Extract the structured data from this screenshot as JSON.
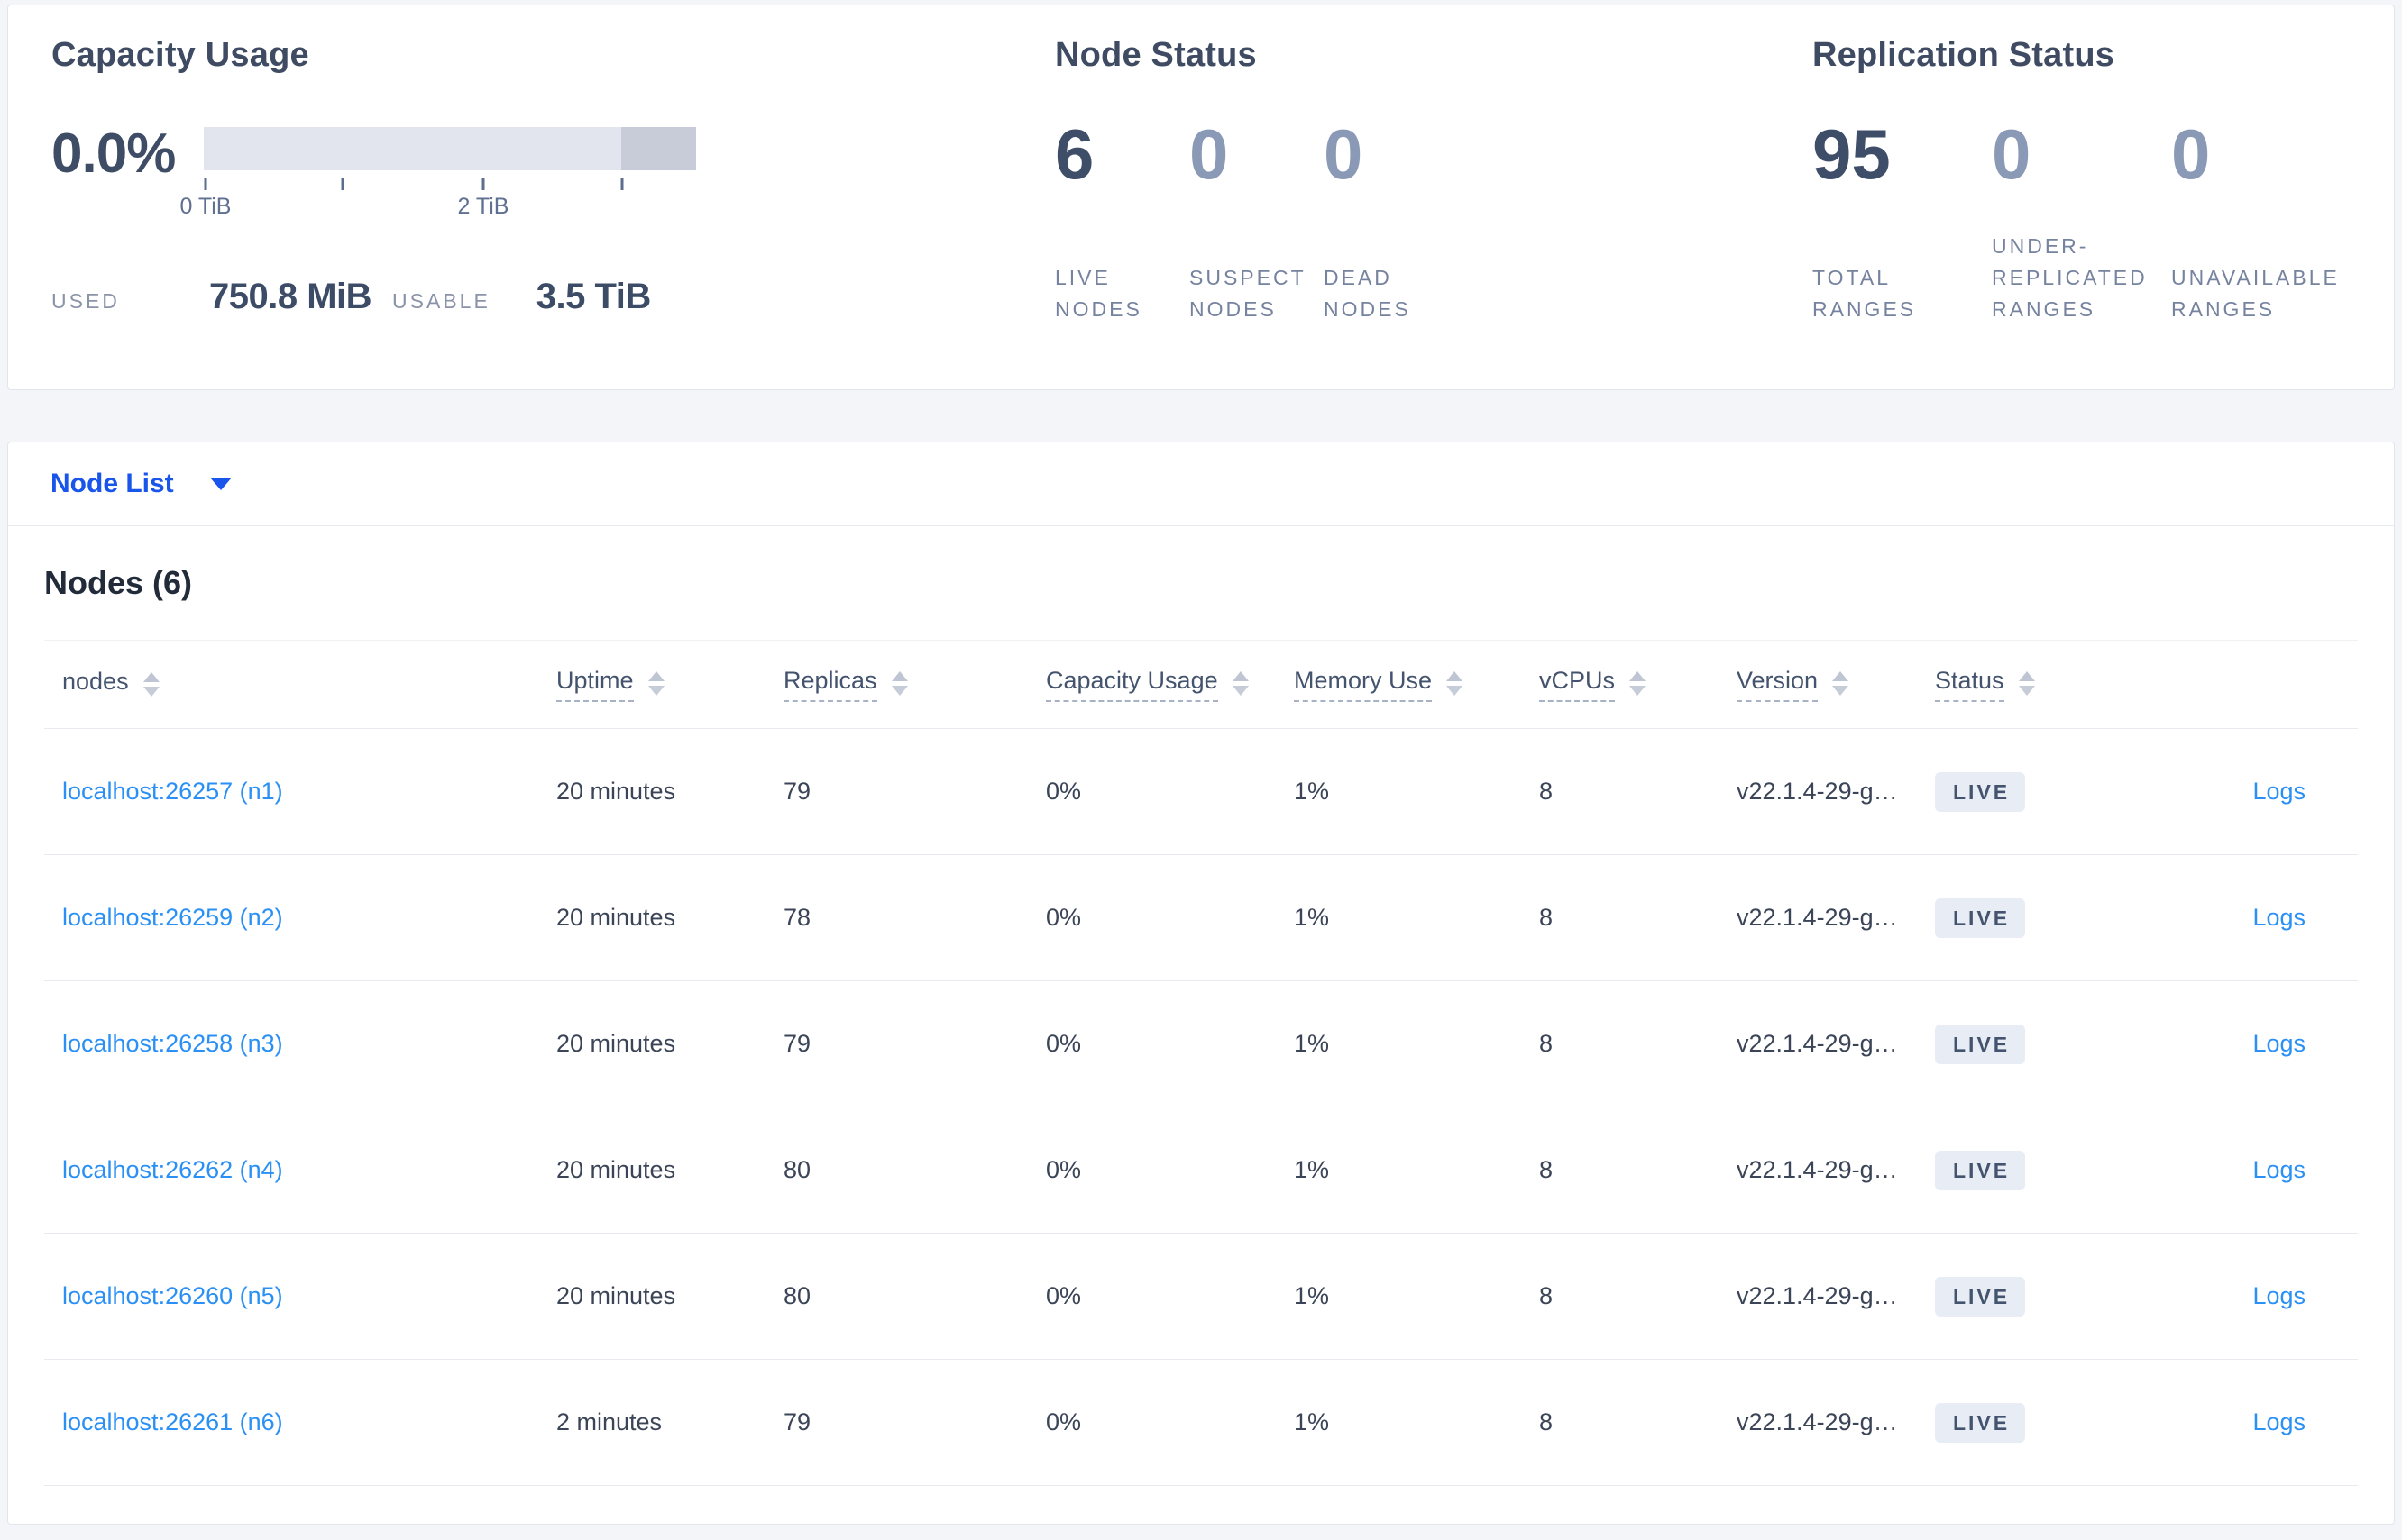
{
  "summary": {
    "capacity": {
      "title": "Capacity Usage",
      "percent": "0.0%",
      "tick_label_0": "0 TiB",
      "tick_label_2": "2 TiB",
      "used_label": "USED",
      "used_value": "750.8 MiB",
      "usable_label": "USABLE",
      "usable_value": "3.5 TiB"
    },
    "node_status": {
      "title": "Node Status",
      "stats": [
        {
          "value": "6",
          "label": "LIVE NODES"
        },
        {
          "value": "0",
          "label": "SUSPECT NODES"
        },
        {
          "value": "0",
          "label": "DEAD NODES"
        }
      ]
    },
    "replication": {
      "title": "Replication Status",
      "stats": [
        {
          "value": "95",
          "label": "TOTAL RANGES"
        },
        {
          "value": "0",
          "label": "UNDER-REPLICATED RANGES"
        },
        {
          "value": "0",
          "label": "UNAVAILABLE RANGES"
        }
      ]
    }
  },
  "node_list": {
    "dropdown_label": "Node List",
    "heading": "Nodes (6)",
    "columns": [
      "nodes",
      "Uptime",
      "Replicas",
      "Capacity Usage",
      "Memory Use",
      "vCPUs",
      "Version",
      "Status"
    ],
    "rows": [
      {
        "node": "localhost:26257 (n1)",
        "uptime": "20 minutes",
        "replicas": "79",
        "capacity": "0%",
        "memory": "1%",
        "vcpus": "8",
        "version": "v22.1.4-29-g…",
        "status": "LIVE",
        "logs": "Logs"
      },
      {
        "node": "localhost:26259 (n2)",
        "uptime": "20 minutes",
        "replicas": "78",
        "capacity": "0%",
        "memory": "1%",
        "vcpus": "8",
        "version": "v22.1.4-29-g…",
        "status": "LIVE",
        "logs": "Logs"
      },
      {
        "node": "localhost:26258 (n3)",
        "uptime": "20 minutes",
        "replicas": "79",
        "capacity": "0%",
        "memory": "1%",
        "vcpus": "8",
        "version": "v22.1.4-29-g…",
        "status": "LIVE",
        "logs": "Logs"
      },
      {
        "node": "localhost:26262 (n4)",
        "uptime": "20 minutes",
        "replicas": "80",
        "capacity": "0%",
        "memory": "1%",
        "vcpus": "8",
        "version": "v22.1.4-29-g…",
        "status": "LIVE",
        "logs": "Logs"
      },
      {
        "node": "localhost:26260 (n5)",
        "uptime": "20 minutes",
        "replicas": "80",
        "capacity": "0%",
        "memory": "1%",
        "vcpus": "8",
        "version": "v22.1.4-29-g…",
        "status": "LIVE",
        "logs": "Logs"
      },
      {
        "node": "localhost:26261 (n6)",
        "uptime": "2 minutes",
        "replicas": "79",
        "capacity": "0%",
        "memory": "1%",
        "vcpus": "8",
        "version": "v22.1.4-29-g…",
        "status": "LIVE",
        "logs": "Logs"
      }
    ]
  },
  "colors": {
    "page_background": "#f4f5f9",
    "dropdown_blue": "#1a55eb",
    "link_blue": "#2a90f5",
    "badge_background": "#e8ecf4",
    "badge_text": "#44536e",
    "bar_light": "#e3e5ee",
    "bar_dark": "#c8ccd9"
  }
}
